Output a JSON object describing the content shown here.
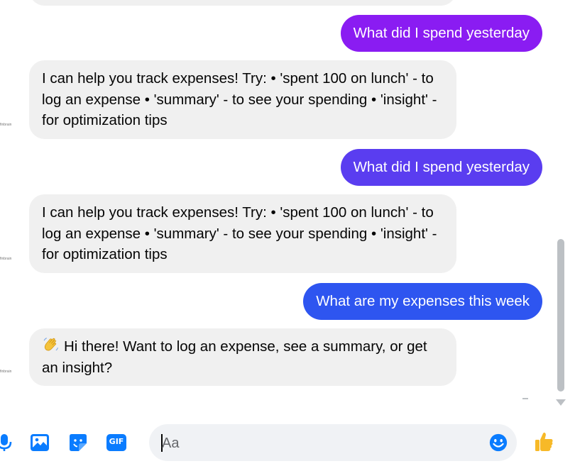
{
  "messages": [
    {
      "role": "user",
      "text": "What did I spend yesterday"
    },
    {
      "role": "bot",
      "avatar_label": "finbrain",
      "text": "I can help you track expenses! Try: • 'spent 100 on lunch' - to log an expense • 'summary' - to see your spending • 'insight' - for optimization tips"
    },
    {
      "role": "user",
      "text": "What did I spend yesterday"
    },
    {
      "role": "bot",
      "avatar_label": "finbrain",
      "text": "I can help you track expenses! Try: • 'spent 100 on lunch' - to log an expense • 'summary' - to see your spending • 'insight' - for optimization tips"
    },
    {
      "role": "user",
      "text": "What are my expenses this week"
    },
    {
      "role": "bot",
      "avatar_label": "finbrain",
      "emoji": "waving-hand-icon",
      "text": "Hi there! Want to log an expense, see a summary, or get an insight?"
    }
  ],
  "composer": {
    "placeholder": "Aa",
    "gif_label": "GIF",
    "icons": [
      "microphone-icon",
      "photo-icon",
      "sticker-icon",
      "gif-icon",
      "emoji-icon",
      "thumbs-up-icon"
    ]
  },
  "colors": {
    "user_bubble_1": "#8a1cf2",
    "user_bubble_2": "#5a3df0",
    "user_bubble_3": "#2e55f0",
    "bot_bubble": "#f0f0f0",
    "accent": "#0a7cff"
  }
}
